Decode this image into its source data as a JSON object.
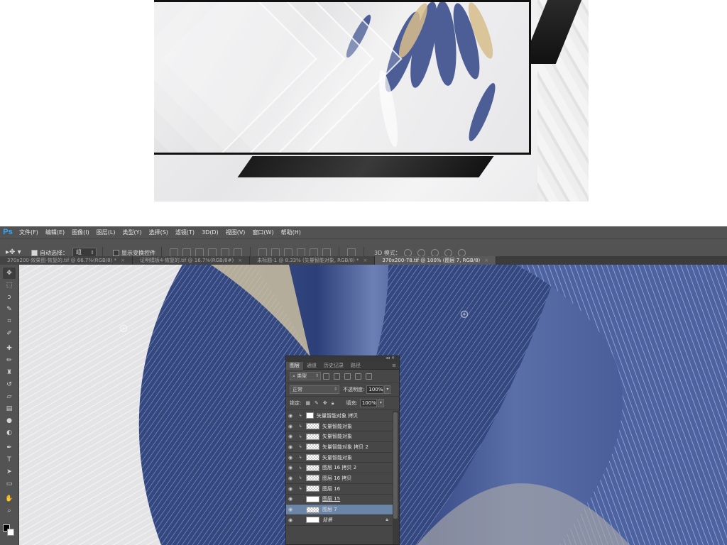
{
  "app": {
    "logo": "Ps"
  },
  "menu": [
    "文件(F)",
    "编辑(E)",
    "图像(I)",
    "图层(L)",
    "类型(Y)",
    "选择(S)",
    "滤镜(T)",
    "3D(D)",
    "视图(V)",
    "窗口(W)",
    "帮助(H)"
  ],
  "options": {
    "auto_select_label": "自动选择：",
    "auto_select_value": "组",
    "show_transform_label": "显示变换控件",
    "mode3d_label": "3D 模式："
  },
  "tabs": [
    {
      "label": "370x200-效果图-恢复的.tif @ 66.7%(RGB/8) *",
      "active": false
    },
    {
      "label": "证明模板4-恢复的.tif @ 16.7%(RGB/8#)",
      "active": false
    },
    {
      "label": "未标题-1 @ 8.33% (矢量智能对象, RGB/8) *",
      "active": false
    },
    {
      "label": "370x200-78.tif @ 100% (图层 7, RGB/8)",
      "active": true
    }
  ],
  "layers_panel": {
    "tabs": [
      "图层",
      "通道",
      "历史记录",
      "路径"
    ],
    "kind_label": "类型",
    "blend_mode": "正常",
    "opacity_label": "不透明度:",
    "opacity_value": "100%",
    "lock_label": "锁定:",
    "fill_label": "填充:",
    "fill_value": "100%",
    "layers": [
      {
        "name": "矢量智能对象 拷贝",
        "thumb": "smart",
        "clipped": true,
        "selected": false
      },
      {
        "name": "矢量智能对象",
        "thumb": "checker",
        "clipped": true,
        "selected": false
      },
      {
        "name": "矢量智能对象",
        "thumb": "checker",
        "clipped": true,
        "selected": false
      },
      {
        "name": "矢量智能对象 拷贝 2",
        "thumb": "checker",
        "clipped": true,
        "selected": false
      },
      {
        "name": "矢量智能对象",
        "thumb": "checker",
        "clipped": true,
        "selected": false
      },
      {
        "name": "图层 16 拷贝 2",
        "thumb": "checker",
        "clipped": true,
        "selected": false
      },
      {
        "name": "图层 16 拷贝",
        "thumb": "checker",
        "clipped": true,
        "selected": false
      },
      {
        "name": "图层 16",
        "thumb": "checker",
        "clipped": true,
        "selected": false
      },
      {
        "name": "图层 15",
        "thumb": "white",
        "clipped": false,
        "selected": false
      },
      {
        "name": "图层 7",
        "thumb": "checker",
        "clipped": false,
        "selected": true
      },
      {
        "name": "背景",
        "thumb": "white",
        "clipped": false,
        "selected": false,
        "locked": true
      }
    ]
  },
  "tools": [
    "move-tool-icon",
    "marquee-tool-icon",
    "lasso-tool-icon",
    "quick-select-tool-icon",
    "crop-tool-icon",
    "eyedropper-tool-icon",
    "healing-brush-icon",
    "brush-tool-icon",
    "clone-stamp-icon",
    "history-brush-icon",
    "eraser-tool-icon",
    "gradient-tool-icon",
    "blur-tool-icon",
    "dodge-tool-icon",
    "pen-tool-icon",
    "type-tool-icon",
    "path-select-icon",
    "rectangle-tool-icon",
    "hand-tool-icon",
    "zoom-tool-icon"
  ],
  "colors": {
    "accent": "#31a8ff",
    "selected_layer": "#6b85a8",
    "feather_blue": "#3a4d88"
  }
}
